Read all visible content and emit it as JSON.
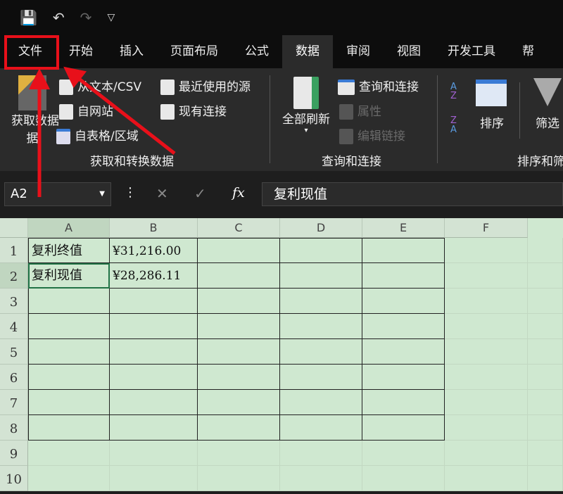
{
  "qat": {
    "save": "💾",
    "undo": "↶",
    "redo": "↷",
    "customize": "▽"
  },
  "tabs": [
    "文件",
    "开始",
    "插入",
    "页面布局",
    "公式",
    "数据",
    "审阅",
    "视图",
    "开发工具",
    "帮"
  ],
  "active_tab": "数据",
  "ribbon": {
    "get_data": "获取数据",
    "get_data2": "据",
    "from_text": "从文本/CSV",
    "from_web": "自网站",
    "from_table": "自表格/区域",
    "recent_sources": "最近使用的源",
    "existing_conn": "现有连接",
    "group1": "获取和转换数据",
    "refresh_all": "全部刷新",
    "queries_conn": "查询和连接",
    "properties": "属性",
    "edit_links": "编辑链接",
    "group2": "查询和连接",
    "sort": "排序",
    "filter": "筛选",
    "group3": "排序和筛"
  },
  "formula_bar": {
    "name_box": "A2",
    "cancel": "✕",
    "enter": "✓",
    "fx": "fx",
    "value": "复利现值"
  },
  "columns": [
    "A",
    "B",
    "C",
    "D",
    "E",
    "F"
  ],
  "rows": [
    "1",
    "2",
    "3",
    "4",
    "5",
    "6",
    "7",
    "8",
    "9",
    "10"
  ],
  "cells": {
    "A1": "复利终值",
    "B1": "¥31,216.00",
    "A2": "复利现值",
    "B2": "¥28,286.11"
  },
  "annotation_color": "#e8101a"
}
